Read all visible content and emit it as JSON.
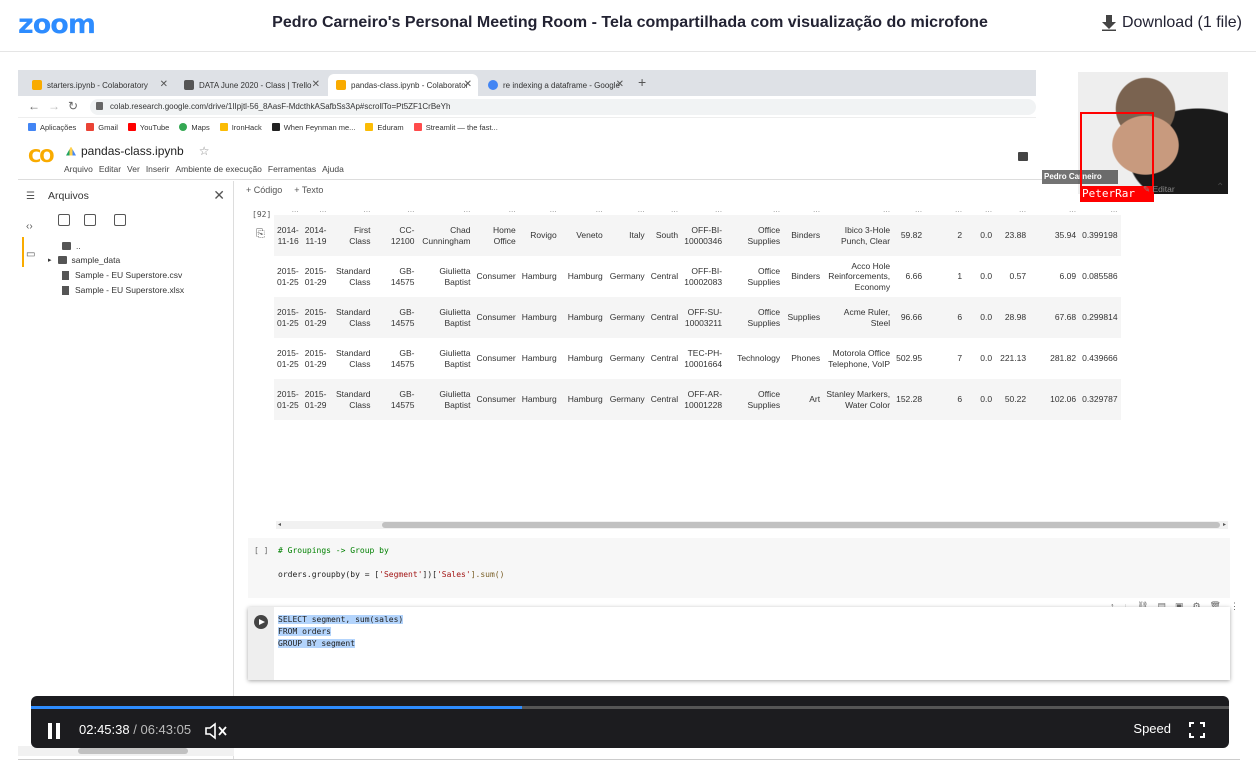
{
  "header": {
    "logo": "zoom",
    "title": "Pedro Carneiro's Personal Meeting Room - Tela compartilhada com visualização do microfone",
    "download_label": "Download (1 file)"
  },
  "browser": {
    "tabs": [
      {
        "label": "starters.ipynb - Colaboratory",
        "icon_color": "#F9AB00",
        "active": false
      },
      {
        "label": "DATA June 2020 - Class | Trello",
        "icon_color": "#555555",
        "active": false
      },
      {
        "label": "pandas-class.ipynb - Colaborator",
        "icon_color": "#F9AB00",
        "active": true
      },
      {
        "label": "re indexing a dataframe - Google",
        "icon_color": "#4285F4",
        "active": false
      }
    ],
    "new_tab": "+",
    "url": "colab.research.google.com/drive/1IIpjtl-56_8AasF-MdcthkASafbSs3Ap#scrollTo=Pt5ZF1CrBeYh",
    "bookmarks": [
      {
        "label": "Aplicações",
        "color": "#4285F4"
      },
      {
        "label": "Gmail",
        "color": "#EA4335"
      },
      {
        "label": "YouTube",
        "color": "#FF0000"
      },
      {
        "label": "Maps",
        "color": "#34A853"
      },
      {
        "label": "IronHack",
        "color": "#FBBC05"
      },
      {
        "label": "When Feynman me...",
        "color": "#222222"
      },
      {
        "label": "Eduram",
        "color": "#FBBC05"
      },
      {
        "label": "Streamlit — the fast...",
        "color": "#FF4B4B"
      }
    ]
  },
  "colab": {
    "logo": "CO",
    "notebook_name": "pandas-class.ipynb",
    "star": "☆",
    "menu": [
      "Arquivo",
      "Editar",
      "Ver",
      "Inserir",
      "Ambiente de execução",
      "Ferramentas",
      "Ajuda"
    ],
    "sidebar": {
      "title": "Arquivos",
      "tree": [
        {
          "label": "..",
          "type": "folder"
        },
        {
          "label": "sample_data",
          "type": "folder"
        },
        {
          "label": "Sample - EU Superstore.csv",
          "type": "file"
        },
        {
          "label": "Sample - EU Superstore.xlsx",
          "type": "file"
        }
      ]
    },
    "toolbar": {
      "code": "+ Código",
      "text": "+ Texto"
    },
    "exec_count": "[92]",
    "editar": "Editar",
    "dataframe": {
      "header": [
        "...",
        "...",
        "...",
        "...",
        "...",
        "...",
        "...",
        "...",
        "...",
        "...",
        "...",
        "...",
        "...",
        "...",
        "...",
        "...",
        "...",
        "...",
        "...",
        "...",
        "..."
      ],
      "rows": [
        [
          "2014-11-16",
          "2014-11-19",
          "First Class",
          "CC-12100",
          "Chad Cunningham",
          "Home Office",
          "Rovigo",
          "Veneto",
          "Italy",
          "South",
          "OFF-BI-10000346",
          "Office Supplies",
          "Binders",
          "Ibico 3-Hole Punch, Clear",
          "59.82",
          "2",
          "0.0",
          "23.88",
          "35.94",
          "0.399198"
        ],
        [
          "2015-01-25",
          "2015-01-29",
          "Standard Class",
          "GB-14575",
          "Giulietta Baptist",
          "Consumer",
          "Hamburg",
          "Hamburg",
          "Germany",
          "Central",
          "OFF-BI-10002083",
          "Office Supplies",
          "Binders",
          "Acco Hole Reinforcements, Economy",
          "6.66",
          "1",
          "0.0",
          "0.57",
          "6.09",
          "0.085586"
        ],
        [
          "2015-01-25",
          "2015-01-29",
          "Standard Class",
          "GB-14575",
          "Giulietta Baptist",
          "Consumer",
          "Hamburg",
          "Hamburg",
          "Germany",
          "Central",
          "OFF-SU-10003211",
          "Office Supplies",
          "Supplies",
          "Acme Ruler, Steel",
          "96.66",
          "6",
          "0.0",
          "28.98",
          "67.68",
          "0.299814"
        ],
        [
          "2015-01-25",
          "2015-01-29",
          "Standard Class",
          "GB-14575",
          "Giulietta Baptist",
          "Consumer",
          "Hamburg",
          "Hamburg",
          "Germany",
          "Central",
          "TEC-PH-10001664",
          "Technology",
          "Phones",
          "Motorola Office Telephone, VoIP",
          "502.95",
          "7",
          "0.0",
          "221.13",
          "281.82",
          "0.439666"
        ],
        [
          "2015-01-25",
          "2015-01-29",
          "Standard Class",
          "GB-14575",
          "Giulietta Baptist",
          "Consumer",
          "Hamburg",
          "Hamburg",
          "Germany",
          "Central",
          "OFF-AR-10001228",
          "Office Supplies",
          "Art",
          "Stanley Markers, Water Color",
          "152.28",
          "6",
          "0.0",
          "50.22",
          "102.06",
          "0.329787"
        ]
      ]
    },
    "cell1": {
      "bracket": "[ ]",
      "comment": "# Groupings -> Group by",
      "code_pre": "orders.groupby(by = [",
      "code_str1": "'Segment'",
      "code_mid": "])[",
      "code_str2": "'Sales'",
      "code_post": "].sum()"
    },
    "cell2": {
      "line1": "SELECT segment, sum(sales)",
      "line2": "FROM orders",
      "line3": "GROUP BY segment"
    }
  },
  "speaker": {
    "name": "Pedro Carneiro",
    "label": "PeterRar"
  },
  "player": {
    "progress": 0.41,
    "current_time": "02:45:38",
    "separator": "/",
    "total_time": "06:43:05",
    "speed_label": "Speed"
  }
}
